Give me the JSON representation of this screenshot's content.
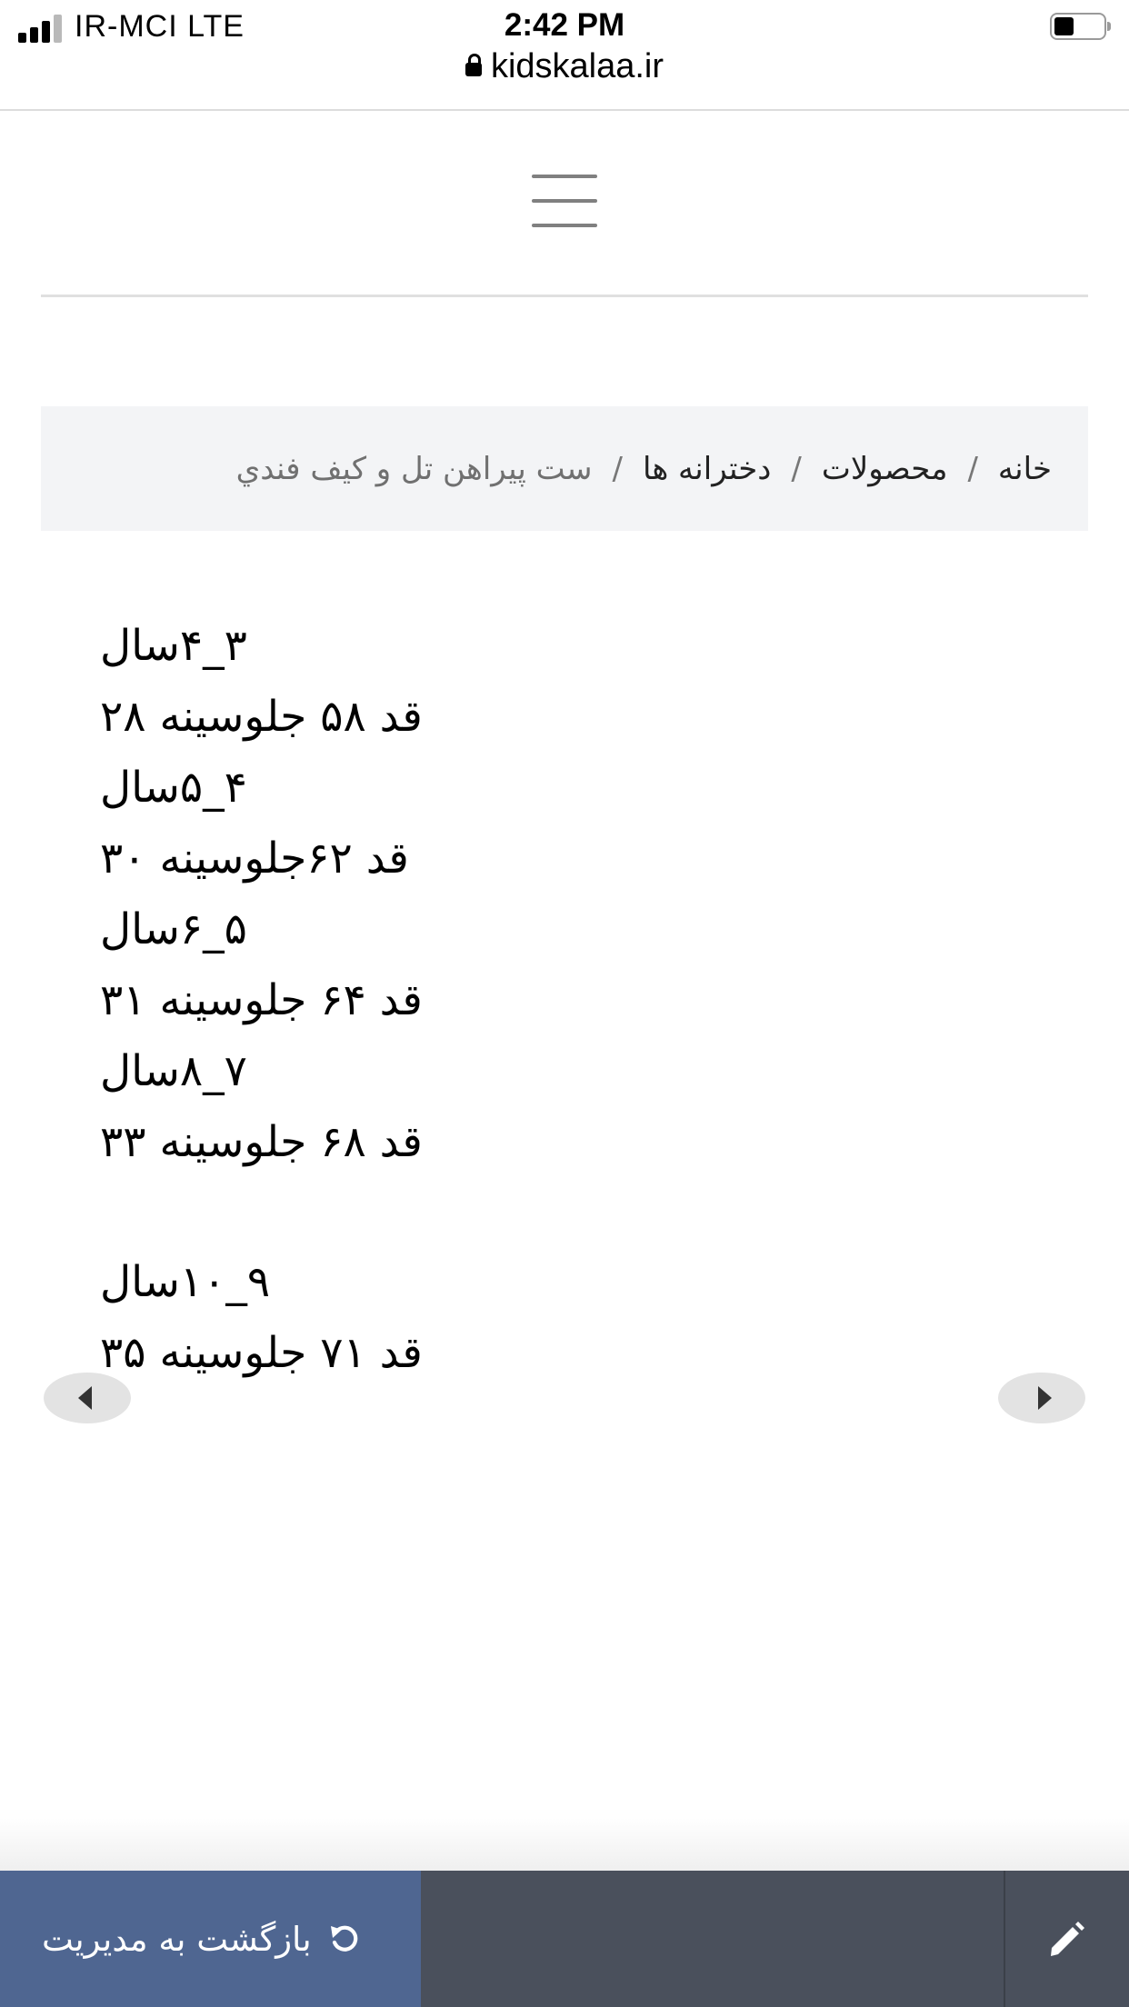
{
  "status_bar": {
    "carrier": "IR-MCI   LTE",
    "time": "2:42 PM",
    "url": "kidskalaa.ir"
  },
  "header": {
    "menu_icon": "hamburger-icon"
  },
  "breadcrumb": {
    "items": [
      "خانه",
      "محصولات",
      "دخترانه ها",
      "ست پیراهن تل و کیف فندي"
    ],
    "separator": "/"
  },
  "description": {
    "lines": [
      "۳_۴سال",
      "قد ۵۸ جلوسینه ۲۸",
      "۴_۵سال",
      "قد ۶۲جلوسینه ۳۰",
      "۵_۶سال",
      "قد ۶۴ جلوسینه ۳۱",
      "۷_۸سال",
      "قد ۶۸ جلوسینه ۳۳",
      "۹_۱۰سال",
      "قد ۷۱ جلوسینه ۳۵"
    ]
  },
  "slider": {
    "prev_icon": "caret-left-icon",
    "next_icon": "caret-right-icon"
  },
  "admin_bar": {
    "back_label": "بازگشت به مدیریت",
    "back_icon": "undo-icon",
    "edit_icon": "pencil-icon",
    "colors": {
      "bar": "#4a505c",
      "back_button": "#4f6691"
    }
  }
}
